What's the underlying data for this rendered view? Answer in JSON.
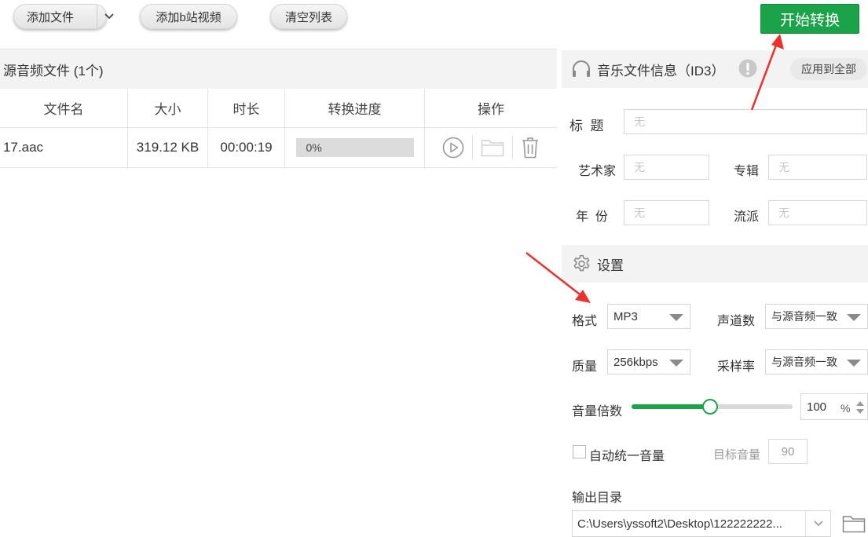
{
  "toolbar": {
    "add_file_label": "添加文件",
    "add_bilibili_label": "添加b站视频",
    "clear_list_label": "清空列表",
    "start_label": "开始转换"
  },
  "files": {
    "header_title": "源音频文件 (1个)",
    "columns": [
      "文件名",
      "大小",
      "时长",
      "转换进度",
      "操作"
    ],
    "rows": [
      {
        "name": "17.aac",
        "size": "319.12 KB",
        "duration": "00:00:19",
        "progress_text": "0%",
        "progress": 0
      }
    ]
  },
  "id3": {
    "title": "音乐文件信息（ID3）",
    "apply_all_label": "应用到全部",
    "title_label": "标  题",
    "title_placeholder": "无",
    "artist_label": "艺术家",
    "artist_placeholder": "无",
    "album_label": "专辑",
    "album_placeholder": "无",
    "year_label": "年  份",
    "year_placeholder": "无",
    "genre_label": "流派",
    "genre_placeholder": "无"
  },
  "settings": {
    "title": "设置",
    "format_label": "格式",
    "format_value": "MP3",
    "channels_label": "声道数",
    "channels_value": "与源音频一致",
    "quality_label": "质量",
    "quality_value": "256kbps",
    "sample_rate_label": "采样率",
    "sample_rate_value": "与源音频一致",
    "volume_label": "音量倍数",
    "volume_value": "100",
    "volume_unit": "%",
    "volume_slider_fraction": 0.49,
    "auto_volume_label": "自动统一音量",
    "auto_volume_checked": false,
    "target_volume_label": "目标音量",
    "target_volume_value": "90",
    "output_dir_label": "输出目录",
    "output_dir_value": "C:\\Users\\yssoft2\\Desktop\\122222222..."
  },
  "colors": {
    "accent_green": "#1ba34a",
    "annotation_red": "#e8322a"
  }
}
